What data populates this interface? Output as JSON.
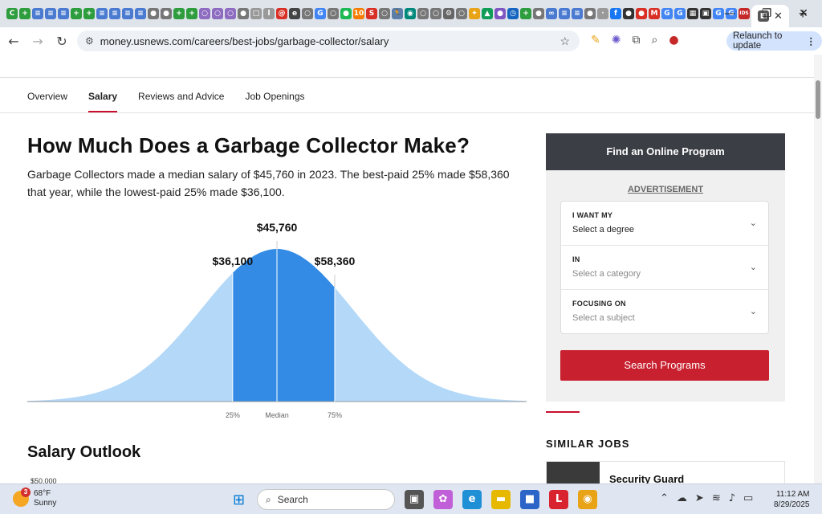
{
  "browser": {
    "tab_icons": [
      {
        "name": "green-app-icon",
        "color": "#2e9d3e",
        "glyph": "C"
      },
      {
        "name": "green-plus-icon",
        "color": "#2e9d3e",
        "glyph": "+"
      },
      {
        "name": "blue-doc-icon",
        "color": "#4a7bd1",
        "glyph": "≡"
      },
      {
        "name": "blue-doc-icon",
        "color": "#4a7bd1",
        "glyph": "≡"
      },
      {
        "name": "blue-doc-icon",
        "color": "#4a7bd1",
        "glyph": "≡"
      },
      {
        "name": "green-plus-icon",
        "color": "#2e9d3e",
        "glyph": "+"
      },
      {
        "name": "green-plus-icon",
        "color": "#2e9d3e",
        "glyph": "+"
      },
      {
        "name": "blue-doc-icon",
        "color": "#4a7bd1",
        "glyph": "≡"
      },
      {
        "name": "blue-doc-icon",
        "color": "#4a7bd1",
        "glyph": "≡"
      },
      {
        "name": "blue-doc-icon",
        "color": "#4a7bd1",
        "glyph": "≡"
      },
      {
        "name": "blue-doc-icon",
        "color": "#4a7bd1",
        "glyph": "≡"
      },
      {
        "name": "gray-circle-icon",
        "color": "#777",
        "glyph": "●"
      },
      {
        "name": "gray-circle-icon",
        "color": "#777",
        "glyph": "●"
      },
      {
        "name": "green-plus-icon",
        "color": "#2e9d3e",
        "glyph": "+"
      },
      {
        "name": "green-plus-icon",
        "color": "#2e9d3e",
        "glyph": "+"
      },
      {
        "name": "ring-icon",
        "color": "#8e6cc1",
        "glyph": "○"
      },
      {
        "name": "ring-icon",
        "color": "#8e6cc1",
        "glyph": "○"
      },
      {
        "name": "ring-icon",
        "color": "#8e6cc1",
        "glyph": "○"
      },
      {
        "name": "gray-circle-icon",
        "color": "#777",
        "glyph": "●"
      },
      {
        "name": "gray-square-icon",
        "color": "#999",
        "glyph": "□"
      },
      {
        "name": "gray-square-icon",
        "color": "#999",
        "glyph": "l"
      },
      {
        "name": "red-app-icon",
        "color": "#d93025",
        "glyph": "@"
      },
      {
        "name": "dark-circle-icon",
        "color": "#444",
        "glyph": "e"
      },
      {
        "name": "gray-circle-icon",
        "color": "#777",
        "glyph": "○"
      },
      {
        "name": "google-icon",
        "color": "#4285f4",
        "glyph": "G"
      },
      {
        "name": "gray-circle-icon",
        "color": "#777",
        "glyph": "○"
      },
      {
        "name": "spotify-icon",
        "color": "#1db954",
        "glyph": "●"
      },
      {
        "name": "orange-app-icon",
        "color": "#f57c00",
        "glyph": "10"
      },
      {
        "name": "red-s-icon",
        "color": "#d93025",
        "glyph": "S"
      },
      {
        "name": "gray-circle-icon",
        "color": "#777",
        "glyph": "○"
      },
      {
        "name": "runner-icon",
        "color": "#5b7fa8",
        "glyph": "🏃"
      },
      {
        "name": "teal-app-icon",
        "color": "#00897b",
        "glyph": "◉"
      },
      {
        "name": "gray-circle-icon",
        "color": "#777",
        "glyph": "○"
      },
      {
        "name": "gray-circle-icon",
        "color": "#777",
        "glyph": "○"
      },
      {
        "name": "gray-gear-icon",
        "color": "#666",
        "glyph": "⚙"
      },
      {
        "name": "gray-circle-icon",
        "color": "#777",
        "glyph": "○"
      },
      {
        "name": "star-app-icon",
        "color": "#e8a317",
        "glyph": "✦"
      },
      {
        "name": "drive-icon",
        "color": "#0f9d58",
        "glyph": "▲"
      },
      {
        "name": "purple-app-icon",
        "color": "#7e57c2",
        "glyph": "●"
      },
      {
        "name": "clock-app-icon",
        "color": "#1565c0",
        "glyph": "◷"
      },
      {
        "name": "green-plus-icon",
        "color": "#2e9d3e",
        "glyph": "+"
      },
      {
        "name": "gray-circle-icon",
        "color": "#777",
        "glyph": "●"
      },
      {
        "name": "link-icon",
        "color": "#4a7bd1",
        "glyph": "∞"
      },
      {
        "name": "blue-doc-icon",
        "color": "#4a7bd1",
        "glyph": "≡"
      },
      {
        "name": "blue-doc-icon",
        "color": "#4a7bd1",
        "glyph": "≡"
      },
      {
        "name": "gray-circle-icon",
        "color": "#777",
        "glyph": "●"
      },
      {
        "name": "gray-square-icon",
        "color": "#999",
        "glyph": "·"
      },
      {
        "name": "facebook-icon",
        "color": "#1877f2",
        "glyph": "f"
      },
      {
        "name": "github-icon",
        "color": "#333",
        "glyph": "●"
      },
      {
        "name": "red-app-icon",
        "color": "#d93025",
        "glyph": "●"
      },
      {
        "name": "gmail-icon",
        "color": "#d93025",
        "glyph": "M"
      },
      {
        "name": "google-icon",
        "color": "#4285f4",
        "glyph": "G"
      },
      {
        "name": "google-icon",
        "color": "#4285f4",
        "glyph": "G"
      },
      {
        "name": "dark-app-icon",
        "color": "#333",
        "glyph": "▦"
      },
      {
        "name": "dark-app-icon",
        "color": "#333",
        "glyph": "▣"
      },
      {
        "name": "google-icon",
        "color": "#4285f4",
        "glyph": "G"
      },
      {
        "name": "google-icon",
        "color": "#4285f4",
        "glyph": "G"
      },
      {
        "name": "red-ids-icon",
        "color": "#c62828",
        "glyph": "IDS"
      }
    ],
    "active_tab_icon": {
      "name": "usnews-tab-icon",
      "color": "#555",
      "glyph": "◧"
    },
    "active_tab_close": "✕",
    "new_tab": "+",
    "window_controls": [
      "—",
      "❐",
      "✕"
    ],
    "url": "money.usnews.com/careers/best-jobs/garbage-collector/salary",
    "relaunch_label": "Relaunch to update"
  },
  "page": {
    "tabs": [
      {
        "label": "Overview",
        "active": false
      },
      {
        "label": "Salary",
        "active": true
      },
      {
        "label": "Reviews and Advice",
        "active": false
      },
      {
        "label": "Job Openings",
        "active": false
      }
    ],
    "title": "How Much Does a Garbage Collector Make?",
    "lede": "Garbage Collectors made a median salary of $45,760 in 2023. The best-paid 25% made $58,360 that year, while the lowest-paid 25% made $36,100.",
    "outlook_title": "Salary Outlook",
    "outlook_first_tick": "$50,000"
  },
  "chart_data": {
    "type": "area",
    "distribution": "normal",
    "markers": [
      {
        "label": "$36,100",
        "axis_label": "25%",
        "value": 36100
      },
      {
        "label": "$45,760",
        "axis_label": "Median",
        "value": 45760
      },
      {
        "label": "$58,360",
        "axis_label": "75%",
        "value": 58360
      }
    ],
    "colors": {
      "tails": "#b3d8f8",
      "middle": "#338be5",
      "divider": "#ffffff",
      "guide": "#cccccc",
      "baseline": "#999999"
    }
  },
  "sidebar": {
    "header": "Find an Online Program",
    "advertisement": "ADVERTISEMENT",
    "fields": [
      {
        "label": "I WANT MY",
        "value": "Select a degree",
        "placeholder": false
      },
      {
        "label": "IN",
        "value": "Select a category",
        "placeholder": true
      },
      {
        "label": "FOCUSING ON",
        "value": "Select a subject",
        "placeholder": true
      }
    ],
    "search_button": "Search Programs",
    "similar_jobs_title": "SIMILAR JOBS",
    "similar_jobs": [
      {
        "title": "Security Guard"
      }
    ]
  },
  "taskbar": {
    "weather_badge": "3",
    "temperature": "68°F",
    "condition": "Sunny",
    "search_label": "Search",
    "apps": [
      {
        "name": "task-view-icon",
        "color": "#555",
        "glyph": "▣"
      },
      {
        "name": "copilot-icon",
        "color": "#c05fd8",
        "glyph": "✿"
      },
      {
        "name": "edge-icon",
        "color": "#1f8fd6",
        "glyph": "e"
      },
      {
        "name": "file-explorer-icon",
        "color": "#e6b800",
        "glyph": "▬"
      },
      {
        "name": "store-icon",
        "color": "#2c64c7",
        "glyph": "■"
      },
      {
        "name": "l-app-icon",
        "color": "#d9242f",
        "glyph": "L"
      },
      {
        "name": "chrome-icon",
        "color": "#e8a317",
        "glyph": "◉"
      }
    ],
    "tray": [
      "⌃",
      "☁",
      "➤",
      "≋",
      "♪",
      "▭"
    ],
    "time": "11:12 AM",
    "date": "8/29/2025"
  }
}
